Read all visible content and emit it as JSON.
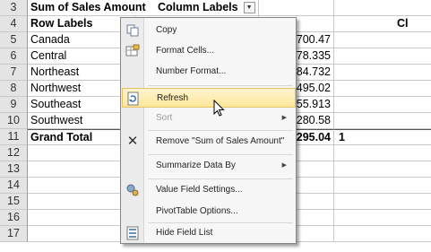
{
  "sheet": {
    "column_header": "Column Labels",
    "header_right_partial": "Cl",
    "rows": [
      {
        "num": "3",
        "a": "Sum of Sales Amount",
        "c": ""
      },
      {
        "num": "4",
        "a": "Row Labels",
        "c": ""
      },
      {
        "num": "5",
        "a": "Canada",
        "c": "4700.47"
      },
      {
        "num": "6",
        "a": "Central",
        "c": "978.335"
      },
      {
        "num": "7",
        "a": "Northeast",
        "c": "284.732"
      },
      {
        "num": "8",
        "a": "Northwest",
        "c": "4495.02"
      },
      {
        "num": "9",
        "a": "Southeast",
        "c": "555.913"
      },
      {
        "num": "10",
        "a": "Southwest",
        "c": "0280.58"
      },
      {
        "num": "11",
        "a": "Grand Total",
        "c": "295.04",
        "d": "1"
      },
      {
        "num": "12",
        "a": "",
        "c": ""
      },
      {
        "num": "13",
        "a": "",
        "c": ""
      },
      {
        "num": "14",
        "a": "",
        "c": ""
      },
      {
        "num": "15",
        "a": "",
        "c": ""
      },
      {
        "num": "16",
        "a": "",
        "c": ""
      },
      {
        "num": "17",
        "a": "",
        "c": ""
      }
    ]
  },
  "menu": {
    "items": [
      {
        "label": "Copy",
        "icon": "copy-icon"
      },
      {
        "label": "Format Cells...",
        "icon": "format-cells-icon"
      },
      {
        "label": "Number Format...",
        "icon": ""
      },
      {
        "label": "Refresh",
        "icon": "refresh-icon",
        "highlighted": true
      },
      {
        "label": "Sort",
        "icon": "",
        "disabled": true,
        "submenu": true
      },
      {
        "label": "Remove \"Sum of Sales Amount\"",
        "icon": "remove-icon"
      },
      {
        "label": "Summarize Data By",
        "icon": "",
        "submenu": true
      },
      {
        "label": "Value Field Settings...",
        "icon": "value-field-settings-icon"
      },
      {
        "label": "PivotTable Options...",
        "icon": ""
      },
      {
        "label": "Hide Field List",
        "icon": "hide-field-list-icon"
      }
    ]
  },
  "colors": {
    "highlight": "#fde79a",
    "menu_bg": "#f7f7f7",
    "row_header_bg": "#e4e4e4"
  }
}
